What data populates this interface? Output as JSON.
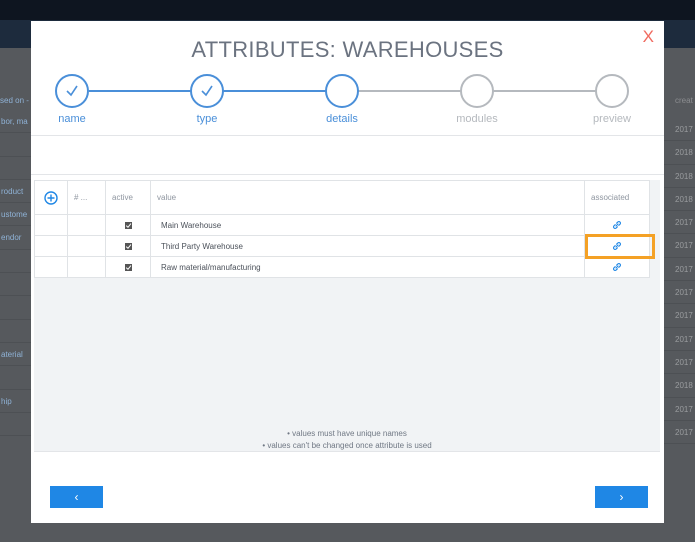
{
  "background": {
    "left_header": "sed on -",
    "right_header": "creat",
    "left_cells": [
      "bor, ma",
      "",
      "",
      "roduct",
      "ustome",
      "endor",
      "",
      "",
      "",
      "",
      "aterial",
      "",
      "hip",
      ""
    ],
    "right_cells": [
      "2017",
      "2018",
      "2018",
      "2018",
      "2017",
      "2017",
      "2017",
      "2017",
      "2017",
      "2017",
      "2017",
      "2018",
      "2017",
      "2017"
    ]
  },
  "modal": {
    "title": "ATTRIBUTES:  WAREHOUSES",
    "close_label": "X",
    "steps": [
      {
        "label": "name",
        "state": "done"
      },
      {
        "label": "type",
        "state": "done"
      },
      {
        "label": "details",
        "state": "active"
      },
      {
        "label": "modules",
        "state": "pending"
      },
      {
        "label": "preview",
        "state": "pending"
      }
    ],
    "table": {
      "headers": {
        "num": "# ...",
        "active": "active",
        "value": "value",
        "associated": "associated"
      },
      "rows": [
        {
          "value": "Main Warehouse",
          "active": true
        },
        {
          "value": "Third Party Warehouse",
          "active": true
        },
        {
          "value": "Raw material/manufacturing",
          "active": true
        }
      ]
    },
    "notes": [
      "values must have unique names",
      "values can't be changed once attribute is used"
    ],
    "prev_label": "‹",
    "next_label": "›"
  },
  "colors": {
    "accent": "#1f87e5",
    "step_done": "#4a8fd9",
    "step_pending": "#b5b9be",
    "close": "#f06a5f",
    "highlight": "#f4a125"
  },
  "icons": [
    "check-icon",
    "add-circle-icon",
    "checkbox-icon",
    "link-icon",
    "chevron-left-icon",
    "chevron-right-icon",
    "close-icon"
  ]
}
